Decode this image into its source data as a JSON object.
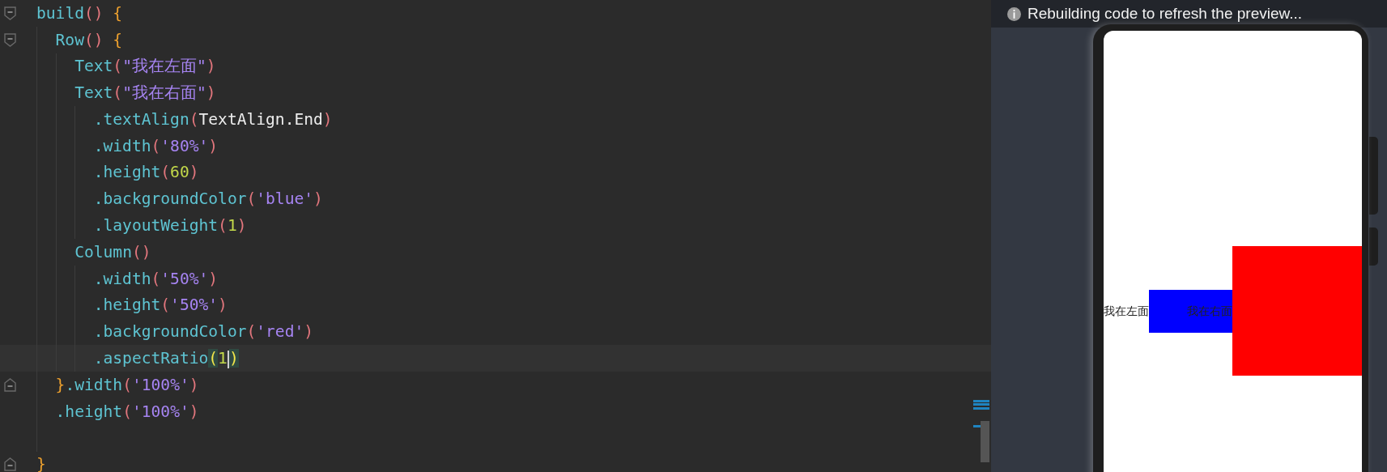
{
  "editor": {
    "lines": [
      {
        "fold_start": true,
        "current": false,
        "tokens": [
          {
            "kind": "fn",
            "text": "build"
          },
          {
            "kind": "paren",
            "text": "()"
          },
          {
            "kind": "brace",
            "text": " {"
          }
        ],
        "children": [
          {
            "fold_start": true,
            "current": false,
            "tokens": [
              {
                "kind": "fn",
                "text": "Row"
              },
              {
                "kind": "paren",
                "text": "()"
              },
              {
                "kind": "brace",
                "text": " {"
              }
            ],
            "children": [
              {
                "current": false,
                "tokens": [
                  {
                    "kind": "fn",
                    "text": "Text"
                  },
                  {
                    "kind": "paren",
                    "text": "("
                  },
                  {
                    "kind": "str",
                    "text": "\"我在左面\""
                  },
                  {
                    "kind": "paren",
                    "text": ")"
                  }
                ]
              },
              {
                "current": false,
                "tokens": [
                  {
                    "kind": "fn",
                    "text": "Text"
                  },
                  {
                    "kind": "paren",
                    "text": "("
                  },
                  {
                    "kind": "str",
                    "text": "\"我在右面\""
                  },
                  {
                    "kind": "paren",
                    "text": ")"
                  }
                ],
                "children": [
                  {
                    "current": false,
                    "tokens": [
                      {
                        "kind": "fn",
                        "text": ".textAlign"
                      },
                      {
                        "kind": "paren",
                        "text": "("
                      },
                      {
                        "kind": "plain",
                        "text": "TextAlign.End"
                      },
                      {
                        "kind": "paren",
                        "text": ")"
                      }
                    ]
                  },
                  {
                    "current": false,
                    "tokens": [
                      {
                        "kind": "fn",
                        "text": ".width"
                      },
                      {
                        "kind": "paren",
                        "text": "("
                      },
                      {
                        "kind": "str",
                        "text": "'80%'"
                      },
                      {
                        "kind": "paren",
                        "text": ")"
                      }
                    ]
                  },
                  {
                    "current": false,
                    "tokens": [
                      {
                        "kind": "fn",
                        "text": ".height"
                      },
                      {
                        "kind": "paren",
                        "text": "("
                      },
                      {
                        "kind": "num",
                        "text": "60"
                      },
                      {
                        "kind": "paren",
                        "text": ")"
                      }
                    ]
                  },
                  {
                    "current": false,
                    "tokens": [
                      {
                        "kind": "fn",
                        "text": ".backgroundColor"
                      },
                      {
                        "kind": "paren",
                        "text": "("
                      },
                      {
                        "kind": "str",
                        "text": "'blue'"
                      },
                      {
                        "kind": "paren",
                        "text": ")"
                      }
                    ]
                  },
                  {
                    "current": false,
                    "tokens": [
                      {
                        "kind": "fn",
                        "text": ".layoutWeight"
                      },
                      {
                        "kind": "paren",
                        "text": "("
                      },
                      {
                        "kind": "num",
                        "text": "1"
                      },
                      {
                        "kind": "paren",
                        "text": ")"
                      }
                    ]
                  }
                ]
              },
              {
                "current": false,
                "tokens": [
                  {
                    "kind": "fn",
                    "text": "Column"
                  },
                  {
                    "kind": "paren",
                    "text": "()"
                  }
                ],
                "children": [
                  {
                    "current": false,
                    "tokens": [
                      {
                        "kind": "fn",
                        "text": ".width"
                      },
                      {
                        "kind": "paren",
                        "text": "("
                      },
                      {
                        "kind": "str",
                        "text": "'50%'"
                      },
                      {
                        "kind": "paren",
                        "text": ")"
                      }
                    ]
                  },
                  {
                    "current": false,
                    "tokens": [
                      {
                        "kind": "fn",
                        "text": ".height"
                      },
                      {
                        "kind": "paren",
                        "text": "("
                      },
                      {
                        "kind": "str",
                        "text": "'50%'"
                      },
                      {
                        "kind": "paren",
                        "text": ")"
                      }
                    ]
                  },
                  {
                    "current": false,
                    "tokens": [
                      {
                        "kind": "fn",
                        "text": ".backgroundColor"
                      },
                      {
                        "kind": "paren",
                        "text": "("
                      },
                      {
                        "kind": "str",
                        "text": "'red'"
                      },
                      {
                        "kind": "paren",
                        "text": ")"
                      }
                    ]
                  },
                  {
                    "current": true,
                    "tokens": [
                      {
                        "kind": "fn",
                        "text": ".aspectRatio"
                      },
                      {
                        "kind": "match",
                        "text": "("
                      },
                      {
                        "kind": "num",
                        "text": "1",
                        "caret": true
                      },
                      {
                        "kind": "match",
                        "text": ")"
                      }
                    ]
                  }
                ]
              }
            ]
          },
          {
            "fold_end": true,
            "current": false,
            "tokens": [
              {
                "kind": "brace",
                "text": "}"
              },
              {
                "kind": "fn",
                "text": ".width"
              },
              {
                "kind": "paren",
                "text": "("
              },
              {
                "kind": "str",
                "text": "'100%'"
              },
              {
                "kind": "paren",
                "text": ")"
              }
            ]
          },
          {
            "current": false,
            "tokens": [
              {
                "kind": "fn",
                "text": ".height"
              },
              {
                "kind": "paren",
                "text": "("
              },
              {
                "kind": "str",
                "text": "'100%'"
              },
              {
                "kind": "paren",
                "text": ")"
              }
            ]
          }
        ]
      },
      {
        "fold_end": true,
        "blank_before": true,
        "current": false,
        "tokens": [
          {
            "kind": "brace",
            "text": "}"
          }
        ]
      }
    ]
  },
  "preview": {
    "notice": "Rebuilding code to refresh the preview...",
    "row": [
      {
        "kind": "label",
        "text": "我在左面"
      },
      {
        "kind": "filled-label",
        "text": "我在右面",
        "color": "#0000ff"
      },
      {
        "kind": "block",
        "color": "#ff0000"
      }
    ]
  }
}
